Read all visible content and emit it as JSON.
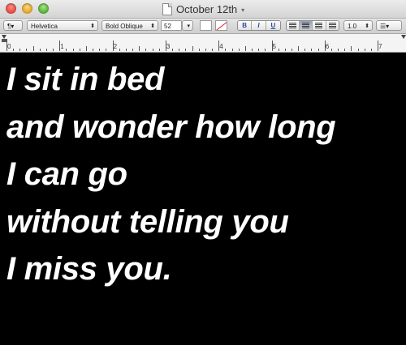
{
  "window": {
    "title": "October 12th",
    "title_arrow": "▾"
  },
  "toolbar": {
    "paragraph_style": "¶▾",
    "font_family": "Helvetica",
    "font_style": "Bold Oblique",
    "font_size": "52",
    "bold_label": "B",
    "italic_label": "I",
    "underline_label": "U",
    "line_spacing": "1.0",
    "list_label": "☰▾",
    "alignment_selected": "center",
    "text_color": "#ffffff"
  },
  "ruler": {
    "numbers": [
      "0",
      "1",
      "2",
      "3",
      "4",
      "5",
      "6",
      "7"
    ]
  },
  "document": {
    "background": "#000000",
    "text_color": "#ffffff",
    "lines": [
      "I sit in bed",
      "and wonder how long",
      "I can go",
      "without telling you",
      "I miss you."
    ]
  }
}
